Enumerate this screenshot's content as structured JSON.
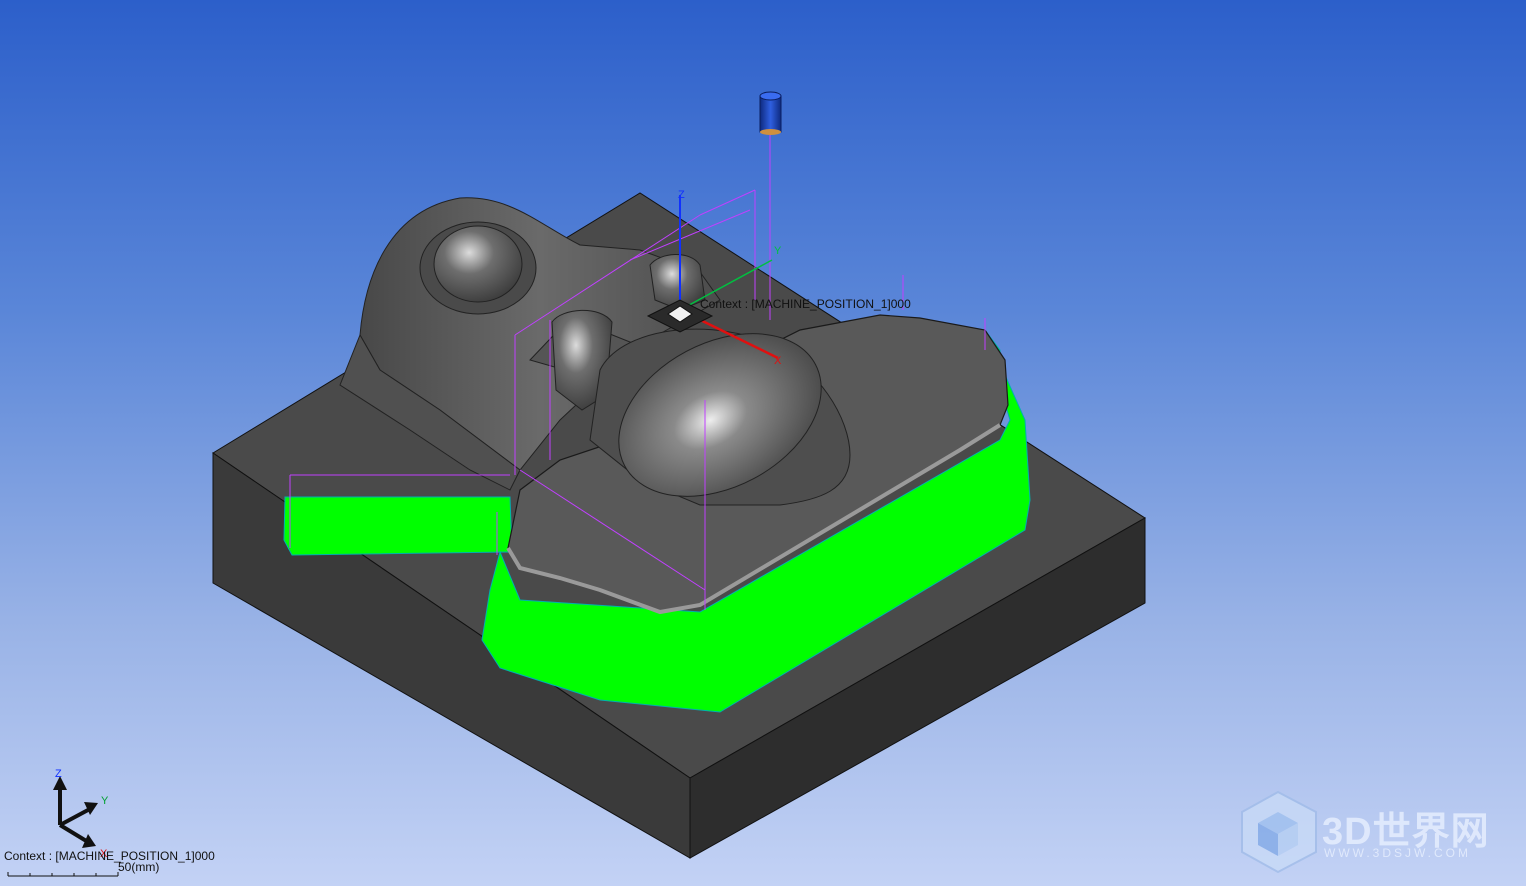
{
  "viewport": {
    "context_model": "Context : [MACHINE_POSITION_1]000",
    "context_corner": "Context : [MACHINE_POSITION_1]000",
    "scale_label": "50(mm)"
  },
  "axes": {
    "model": {
      "x": "X",
      "y": "Y",
      "z": "Z"
    },
    "triad": {
      "x": "X",
      "y": "Y",
      "z": "Z"
    }
  },
  "watermark": {
    "text": "3D世界网",
    "url": "WWW.3DSJW.COM"
  },
  "colors": {
    "background_top": "#2c5fca",
    "background_bottom": "#c3d2f5",
    "stock": "#3e3e3e",
    "part": "#5a5a5a",
    "toolpath_fill": "#00ff00",
    "toolpath_lines": "#c040ff",
    "tool": "#1a3fb0"
  },
  "icons": [
    "cutting-tool-icon",
    "axis-triad-icon",
    "watermark-cube-icon"
  ]
}
